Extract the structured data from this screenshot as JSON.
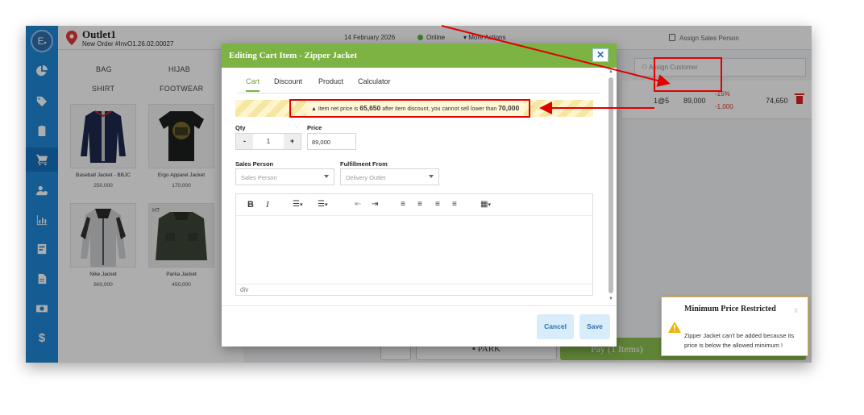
{
  "sidebar": {
    "avatar_letter": "E",
    "items": [
      "pie-chart-icon",
      "tag-icon",
      "clipboard-icon",
      "cart-icon",
      "customers-icon",
      "bar-chart-icon",
      "report-icon",
      "document-icon",
      "cash-icon",
      "dollar-icon"
    ],
    "active_item": "cart-icon"
  },
  "header": {
    "outlet_name": "Outlet1",
    "order_number": "New Order #InvO1.26.02.00027",
    "date": "14 February 2026",
    "status": "Online",
    "more_actions": "More Actions",
    "assign_sales_person": "Assign Sales Person"
  },
  "categories": [
    "BAG",
    "HIJAB",
    "SHIRT",
    "FOOTWEAR"
  ],
  "products": [
    {
      "name": "Baseball Jacket - BBJC",
      "price": "250,000"
    },
    {
      "name": "Ergo Apparel Jacket",
      "price": "170,000"
    },
    {
      "name": "Nike Jacket",
      "price": "600,000"
    },
    {
      "name": "Parka Jacket",
      "price": "450,000"
    }
  ],
  "cart": {
    "customer_placeholder": "Assign Customer",
    "line": {
      "qty_at": "1@5",
      "price": "89,000",
      "discount_percent": "-15%",
      "discount_amount": "-1,000",
      "total": "74,650"
    },
    "park_label": "PARK",
    "pay_label": "Pay (1 Items)"
  },
  "modal": {
    "title": "Editing Cart Item - Zipper Jacket",
    "close_label": "✕",
    "tabs": [
      "Cart",
      "Discount",
      "Product",
      "Calculator"
    ],
    "active_tab": "Cart",
    "warning": {
      "prefix": "Item net price is",
      "net_price": "65,650",
      "middle": "after item discount, you cannot sell lower than",
      "min_price": "70,000"
    },
    "qty_label": "Qty",
    "qty_minus": "-",
    "qty_value": "1",
    "qty_plus": "+",
    "price_label": "Price",
    "price_value": "89,000",
    "sales_person_label": "Sales Person",
    "sales_person_placeholder": "Sales Person",
    "fulfillment_label": "Fulfillment From",
    "fulfillment_placeholder": "Delivery Outlet",
    "editor_toolbar": {
      "bold": "B",
      "italic": "I"
    },
    "editor_footer": "div",
    "cancel_label": "Cancel",
    "save_label": "Save"
  },
  "toast": {
    "title": "Minimum Price Restricted",
    "message": "Zipper Jacket can't be added because its price is below the allowed minimum !",
    "close_label": "x"
  },
  "colors": {
    "sidebar": "#1e88d8",
    "modal_header": "#7cb342",
    "annotation_red": "#e00000",
    "discount_red": "#e53935",
    "warning_stripe": "#f6e6a2",
    "toast_border": "#f0a830"
  }
}
